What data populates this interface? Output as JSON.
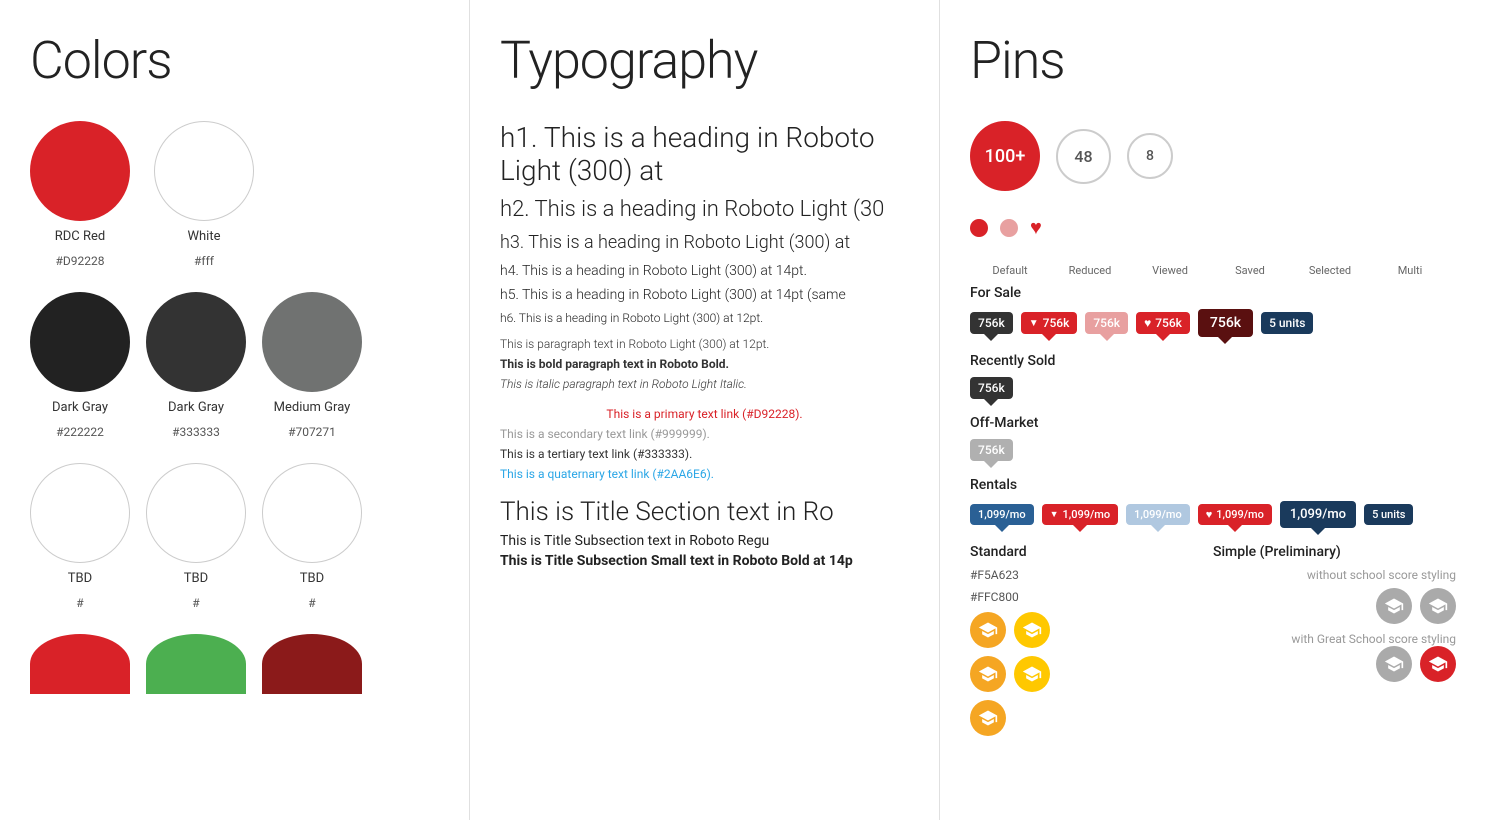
{
  "colors": {
    "title": "Colors",
    "swatches": [
      {
        "name": "RDC Red",
        "hex": "#D92228",
        "class": "swatch-rdc-red"
      },
      {
        "name": "White",
        "hex": "#fff",
        "class": "swatch-white"
      },
      {
        "name": "",
        "hex": "",
        "class": ""
      },
      {
        "name": "Dark Gray",
        "hex": "#222222",
        "class": "swatch-dark-gray1"
      },
      {
        "name": "Dark Gray",
        "hex": "#333333",
        "class": "swatch-dark-gray2"
      },
      {
        "name": "Medium Gray",
        "hex": "#707271",
        "class": "swatch-medium-gray"
      },
      {
        "name": "TBD",
        "hex": "#",
        "class": "swatch-tbd1"
      },
      {
        "name": "TBD",
        "hex": "#",
        "class": "swatch-tbd2"
      },
      {
        "name": "TBD",
        "hex": "#",
        "class": "swatch-tbd3"
      }
    ],
    "bottom_swatches": [
      {
        "name": "",
        "hex": "",
        "class": "swatch-red-bottom"
      },
      {
        "name": "",
        "hex": "",
        "class": "swatch-green-bottom"
      },
      {
        "name": "",
        "hex": "",
        "class": "swatch-dark-red-bottom"
      }
    ]
  },
  "typography": {
    "title": "Typography",
    "h1": "h1. This is a heading in Roboto Light (300) at",
    "h2": "h2. This is a heading in Roboto Light (30",
    "h3": "h3. This is a heading in Roboto Light (300) at",
    "h4": "h4. This is a heading in Roboto Light (300) at 14pt.",
    "h5": "h5. This is a heading in Roboto Light (300) at 14pt (same",
    "h6": "h6. This is a heading in Roboto Light (300) at 12pt.",
    "paragraph": "This is paragraph text in Roboto Light (300) at 12pt.",
    "bold": "This is bold paragraph text in Roboto Bold.",
    "italic": "This is italic paragraph text in Roboto Light Italic.",
    "link_primary": "This is a primary text link (#D92228).",
    "link_secondary": "This is a secondary text link (#999999).",
    "link_tertiary": "This is a tertiary text link (#333333).",
    "link_quaternary": "This is a quaternary text link (#2AA6E6).",
    "title_section": "This is Title Section text in Ro",
    "title_subsection": "This is Title Subsection text in Roboto Regu",
    "title_subsection_small": "This is Title Subsection Small text in Roboto Bold at 14p"
  },
  "pins": {
    "title": "Pins",
    "bubbles": [
      {
        "label": "100+",
        "size": "lg",
        "style": "red"
      },
      {
        "label": "48",
        "size": "md",
        "style": "gray"
      },
      {
        "label": "8",
        "size": "sm",
        "style": "gray"
      }
    ],
    "column_labels": [
      "Default",
      "Reduced",
      "Viewed",
      "Saved",
      "Selected",
      "Multi"
    ],
    "for_sale_label": "For Sale",
    "for_sale_tags": [
      {
        "text": "756k",
        "style": "dark"
      },
      {
        "text": "756k",
        "style": "red",
        "icon": "▼"
      },
      {
        "text": "756k",
        "style": "pink"
      },
      {
        "text": "756k",
        "style": "red",
        "icon": "♥"
      },
      {
        "text": "756k",
        "style": "selected"
      },
      {
        "text": "5 units",
        "style": "navy"
      }
    ],
    "recently_sold_label": "Recently Sold",
    "recently_sold_tags": [
      {
        "text": "756k",
        "style": "dark"
      }
    ],
    "off_market_label": "Off-Market",
    "off_market_tags": [
      {
        "text": "756k",
        "style": "light"
      }
    ],
    "rentals_label": "Rentals",
    "rentals_tags": [
      {
        "text": "1,099/mo",
        "style": "rent"
      },
      {
        "text": "1,099/mo",
        "style": "red",
        "icon": "▼"
      },
      {
        "text": "1,099/mo",
        "style": "rent-light"
      },
      {
        "text": "1,099/mo",
        "style": "red",
        "icon": "♥"
      },
      {
        "text": "1,099/mo",
        "style": "rent-selected"
      },
      {
        "text": "5 units",
        "style": "navy"
      }
    ],
    "standard_label": "Standard",
    "simple_label": "Simple (Preliminary)",
    "color1": "#F5A623",
    "color2": "#FFC800",
    "without_school": "without school score styling",
    "with_school": "with Great School score styling"
  }
}
